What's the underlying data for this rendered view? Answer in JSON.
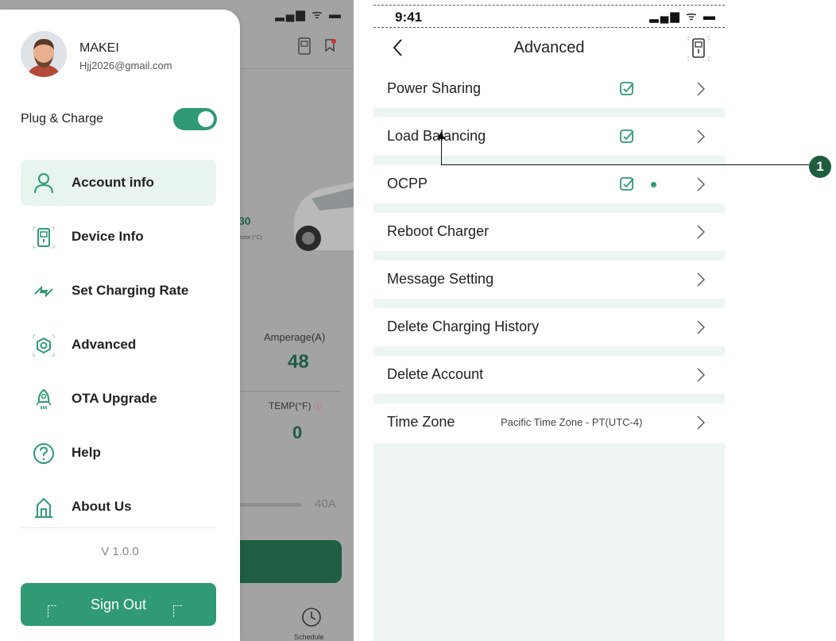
{
  "background_app": {
    "status_icons": "▂▄▆ ᯤ ▬",
    "temperature_value": "30",
    "temperature_unit": "nector (°C)",
    "amperage_label": "Amperage(A)",
    "amperage_value": "48",
    "temp_label": "TEMP(°F)",
    "temp_value": "0",
    "slider_max": "40A",
    "schedule_label": "Schedule"
  },
  "drawer": {
    "user_name": "MAKEI",
    "user_email": "Hjj2026@gmail.com",
    "plug_charge_label": "Plug & Charge",
    "plug_charge_enabled": true,
    "menu": [
      {
        "label": "Account info",
        "icon": "person-icon",
        "active": true
      },
      {
        "label": "Device Info",
        "icon": "charger-icon",
        "active": false
      },
      {
        "label": "Set Charging Rate",
        "icon": "swap-arrows-icon",
        "active": false
      },
      {
        "label": "Advanced",
        "icon": "eye-gear-icon",
        "active": false
      },
      {
        "label": "OTA Upgrade",
        "icon": "rocket-icon",
        "active": false
      },
      {
        "label": "Help",
        "icon": "help-icon",
        "active": false
      },
      {
        "label": "About Us",
        "icon": "building-icon",
        "active": false
      }
    ],
    "version": "V 1.0.0",
    "sign_out_label": "Sign Out"
  },
  "advanced": {
    "status_time": "9:41",
    "status_icons": "▂▄▆ ᯤ ▬",
    "title": "Advanced",
    "rows": [
      {
        "label": "Power Sharing",
        "checked": true,
        "dot": false,
        "value": ""
      },
      {
        "label": "Load Balancing",
        "checked": true,
        "dot": false,
        "value": ""
      },
      {
        "label": "OCPP",
        "checked": true,
        "dot": true,
        "value": ""
      },
      {
        "label": "Reboot Charger",
        "checked": false,
        "dot": false,
        "value": ""
      },
      {
        "label": "Message Setting",
        "checked": false,
        "dot": false,
        "value": ""
      },
      {
        "label": "Delete Charging History",
        "checked": false,
        "dot": false,
        "value": ""
      },
      {
        "label": "Delete Account",
        "checked": false,
        "dot": false,
        "value": ""
      },
      {
        "label": "Time Zone",
        "checked": false,
        "dot": false,
        "value": "Pacific Time Zone - PT(UTC-4)"
      }
    ]
  },
  "annotation": {
    "number": "1"
  },
  "colors": {
    "accent": "#2f9a74",
    "dark_green": "#1e5d43",
    "list_bg": "#eef5f1"
  }
}
